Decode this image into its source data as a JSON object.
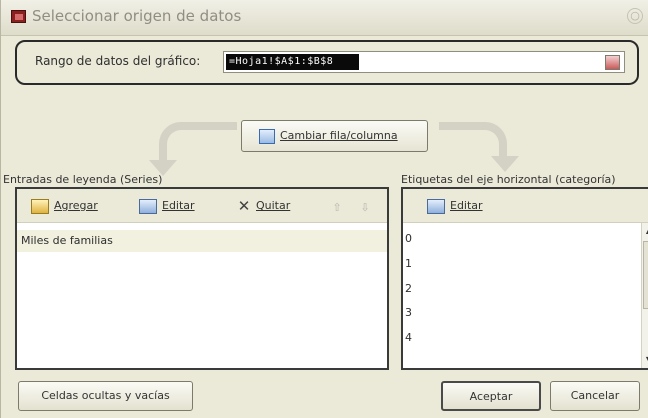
{
  "window": {
    "title": "Seleccionar origen de datos",
    "close_glyph": "○"
  },
  "range": {
    "label": "Rango de datos del gráfico:",
    "value": "=Hoja1!$A$1:$B$8",
    "pick_icon": "range-select-icon"
  },
  "switch": {
    "label": "Cambiar fila/columna",
    "icon": "switch-row-column-icon"
  },
  "series": {
    "heading": "Entradas de leyenda (Series)",
    "add_label": "Agregar",
    "edit_label": "Editar",
    "remove_label": "Quitar",
    "remove_glyph": "✕",
    "up_glyph": "⇧",
    "down_glyph": "⇩",
    "items": [
      "Miles de familias"
    ]
  },
  "categories": {
    "heading": "Etiquetas del eje horizontal (categoría)",
    "edit_label": "Editar",
    "items": [
      "0",
      "1",
      "2",
      "3",
      "4"
    ],
    "scroll_up_glyph": "▲",
    "scroll_down_glyph": "▼"
  },
  "buttons": {
    "hidden_empty": "Celdas ocultas y vacías",
    "accept": "Aceptar",
    "cancel": "Cancelar"
  }
}
